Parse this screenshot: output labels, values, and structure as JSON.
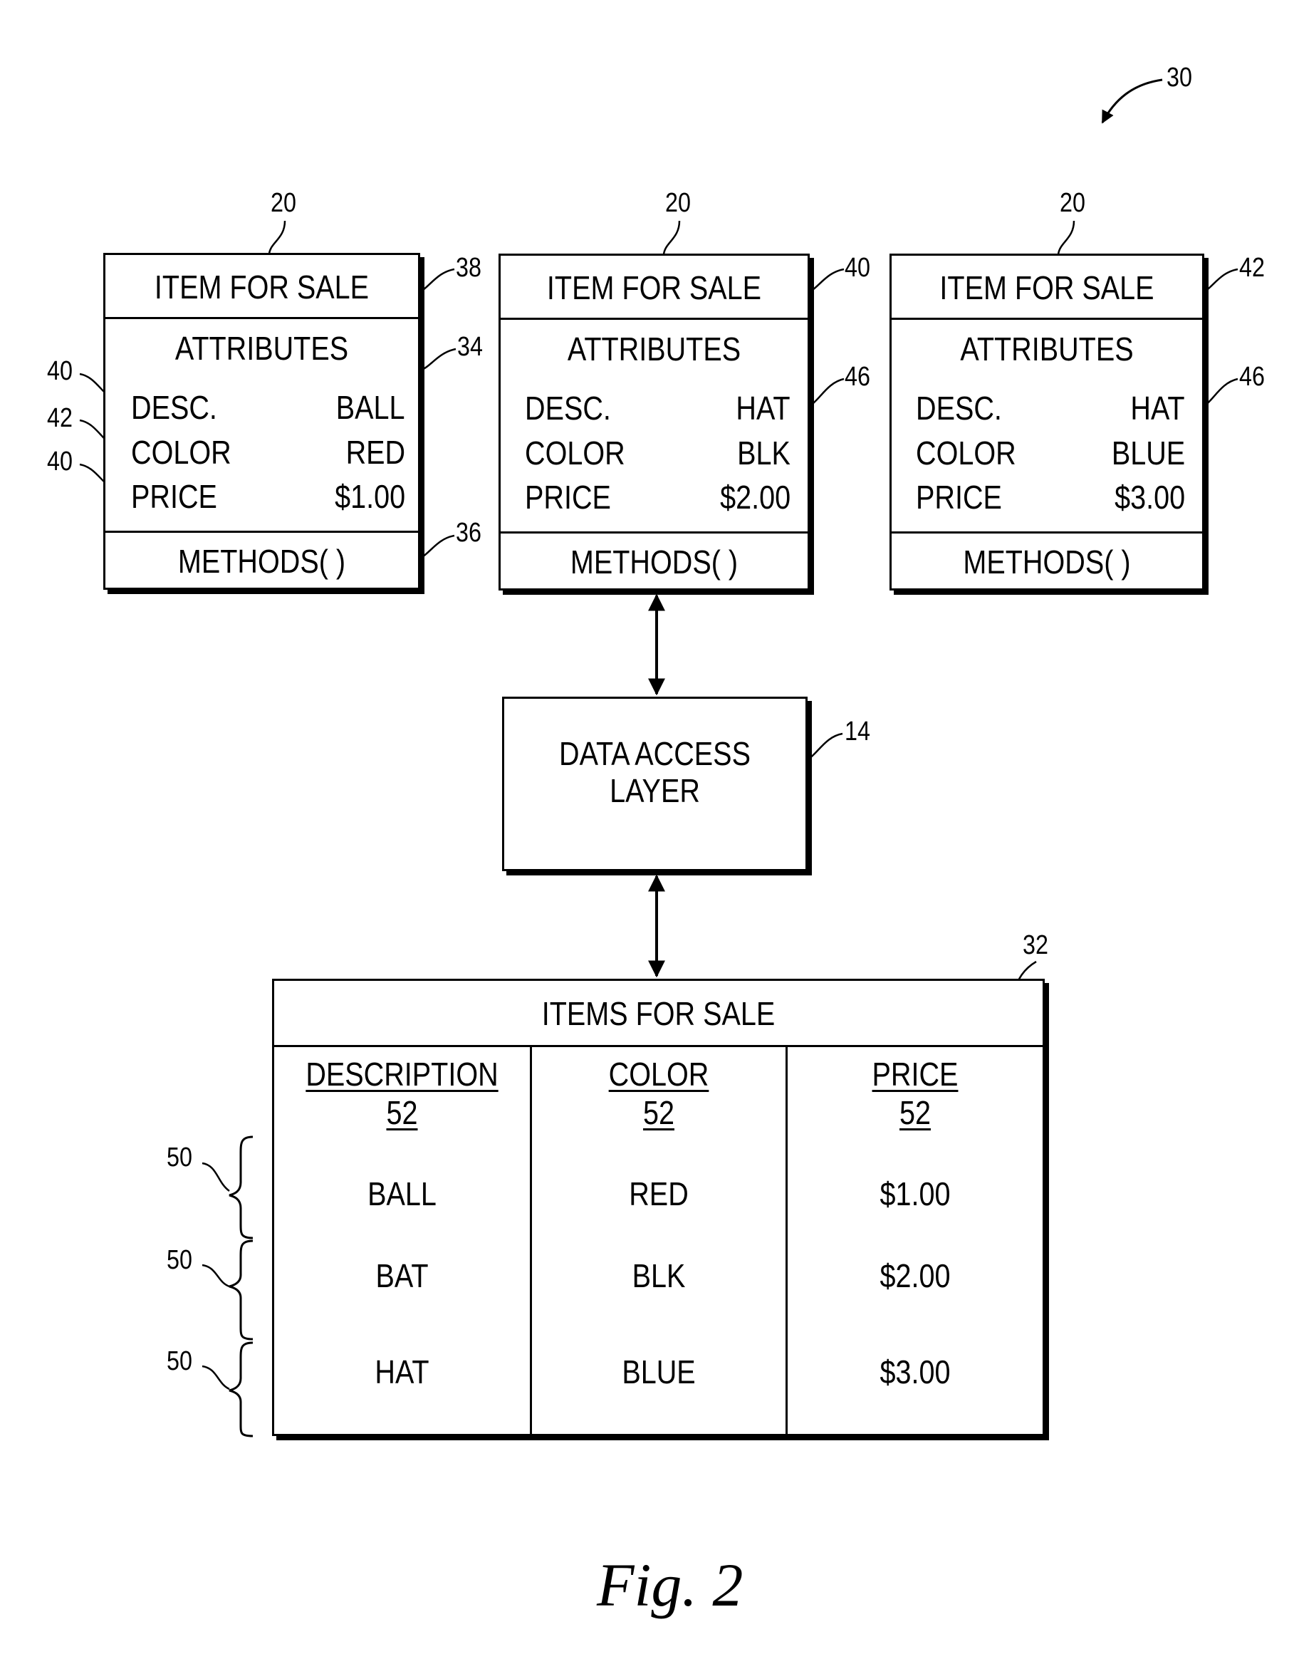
{
  "figure": {
    "ref": "30",
    "caption": "Fig. 2"
  },
  "objects": [
    {
      "ref_top": "20",
      "title": "ITEM FOR SALE",
      "title_ref": "38",
      "attributes_label": "ATTRIBUTES",
      "attributes_ref": "34",
      "attributes": [
        {
          "label": "DESC.",
          "value": "BALL",
          "ref": "40"
        },
        {
          "label": "COLOR",
          "value": "RED",
          "ref": "42"
        },
        {
          "label": "PRICE",
          "value": "$1.00",
          "ref": "40"
        }
      ],
      "methods_label": "METHODS( )",
      "methods_ref": "36"
    },
    {
      "ref_top": "20",
      "title": "ITEM FOR SALE",
      "title_ref": "40",
      "attributes_label": "ATTRIBUTES",
      "attributes_ref": "46",
      "attributes": [
        {
          "label": "DESC.",
          "value": "HAT"
        },
        {
          "label": "COLOR",
          "value": "BLK"
        },
        {
          "label": "PRICE",
          "value": "$2.00"
        }
      ],
      "methods_label": "METHODS( )"
    },
    {
      "ref_top": "20",
      "title": "ITEM FOR SALE",
      "title_ref": "42",
      "attributes_label": "ATTRIBUTES",
      "attributes_ref": "46",
      "attributes": [
        {
          "label": "DESC.",
          "value": "HAT"
        },
        {
          "label": "COLOR",
          "value": "BLUE"
        },
        {
          "label": "PRICE",
          "value": "$3.00"
        }
      ],
      "methods_label": "METHODS( )"
    }
  ],
  "data_access_layer": {
    "line1": "DATA ACCESS",
    "line2": "LAYER",
    "ref": "14"
  },
  "table": {
    "title": "ITEMS FOR SALE",
    "ref": "32",
    "columns": [
      {
        "name": "DESCRIPTION",
        "ref": "52"
      },
      {
        "name": "COLOR",
        "ref": "52"
      },
      {
        "name": "PRICE",
        "ref": "52"
      }
    ],
    "rows": [
      {
        "ref": "50",
        "cells": [
          "BALL",
          "RED",
          "$1.00"
        ]
      },
      {
        "ref": "50",
        "cells": [
          "BAT",
          "BLK",
          "$2.00"
        ]
      },
      {
        "ref": "50",
        "cells": [
          "HAT",
          "BLUE",
          "$3.00"
        ]
      }
    ]
  }
}
